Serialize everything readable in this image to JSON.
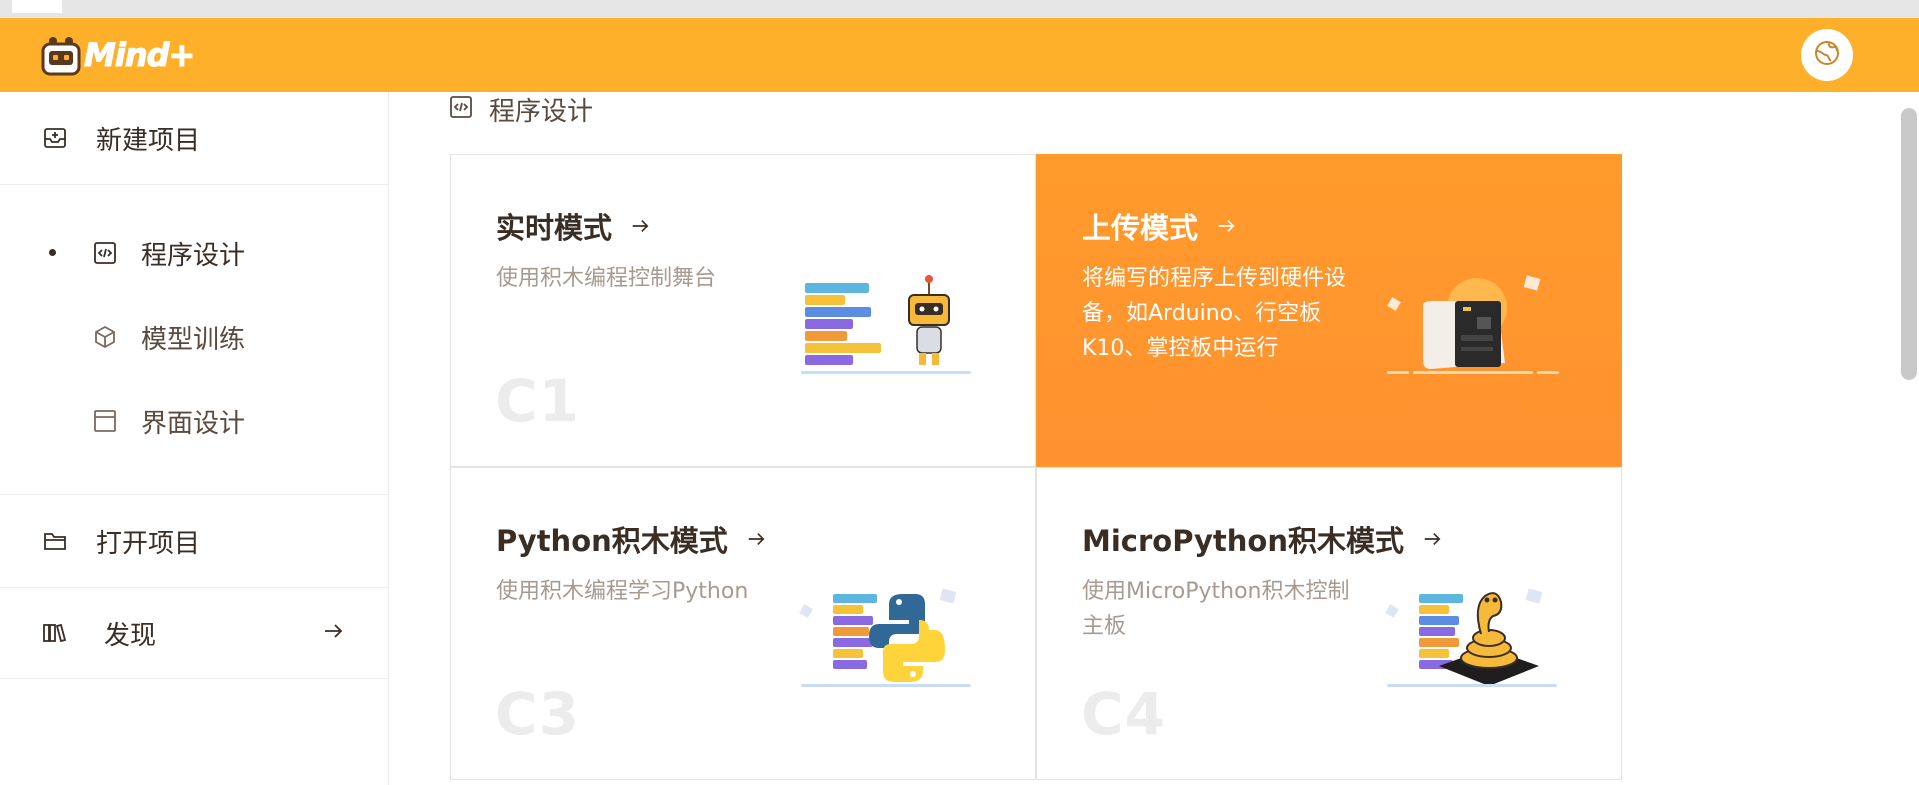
{
  "app": {
    "name": "Mind+"
  },
  "sidebar": {
    "new_project": "新建项目",
    "group": {
      "programming": "程序设计",
      "model_training": "模型训练",
      "ui_design": "界面设计"
    },
    "open_project": "打开项目",
    "discover": "发现"
  },
  "main": {
    "section_title": "程序设计",
    "cards": [
      {
        "title": "实时模式",
        "desc": "使用积木编程控制舞台",
        "code": "C1"
      },
      {
        "title": "上传模式",
        "desc": "将编写的程序上传到硬件设备，如Arduino、行空板K10、掌控板中运行",
        "code": ""
      },
      {
        "title": "Python积木模式",
        "desc": "使用积木编程学习Python",
        "code": "C3"
      },
      {
        "title": "MicroPython积木模式",
        "desc": "使用MicroPython积木控制主板",
        "code": "C4"
      }
    ]
  },
  "colors": {
    "header": "#ffb02a",
    "active_card": "#ff9a2c",
    "text": "#3a2e24",
    "muted": "#a79b90"
  },
  "icons": [
    "mind-logo-icon",
    "globe-icon",
    "new-project-icon",
    "code-icon",
    "cube-icon",
    "window-icon",
    "folder-icon",
    "books-icon",
    "arrow-right-icon"
  ]
}
